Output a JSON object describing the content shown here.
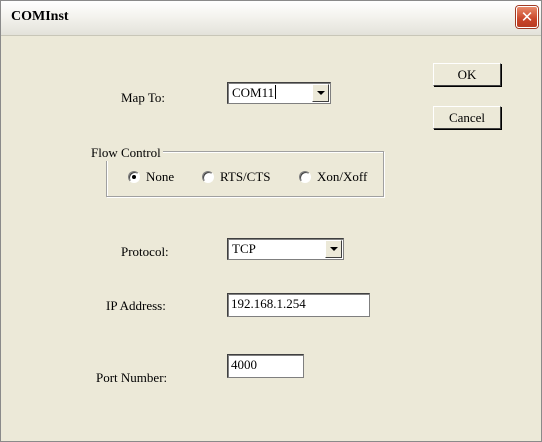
{
  "window": {
    "title": "COMInst"
  },
  "buttons": {
    "ok": "OK",
    "cancel": "Cancel"
  },
  "map_to": {
    "label": "Map To:",
    "value": "COM11"
  },
  "flow_control": {
    "title": "Flow Control",
    "options": [
      {
        "label": "None",
        "selected": true
      },
      {
        "label": "RTS/CTS",
        "selected": false
      },
      {
        "label": "Xon/Xoff",
        "selected": false
      }
    ]
  },
  "protocol": {
    "label": "Protocol:",
    "value": "TCP"
  },
  "ip_address": {
    "label": "IP Address:",
    "value": "192.168.1.254"
  },
  "port_number": {
    "label": "Port Number:",
    "value": "4000"
  },
  "icons": {
    "close": "close-icon",
    "dropdown": "chevron-down-icon"
  },
  "colors": {
    "dialog_bg": "#ece9d8",
    "close_button": "#c9462a"
  }
}
